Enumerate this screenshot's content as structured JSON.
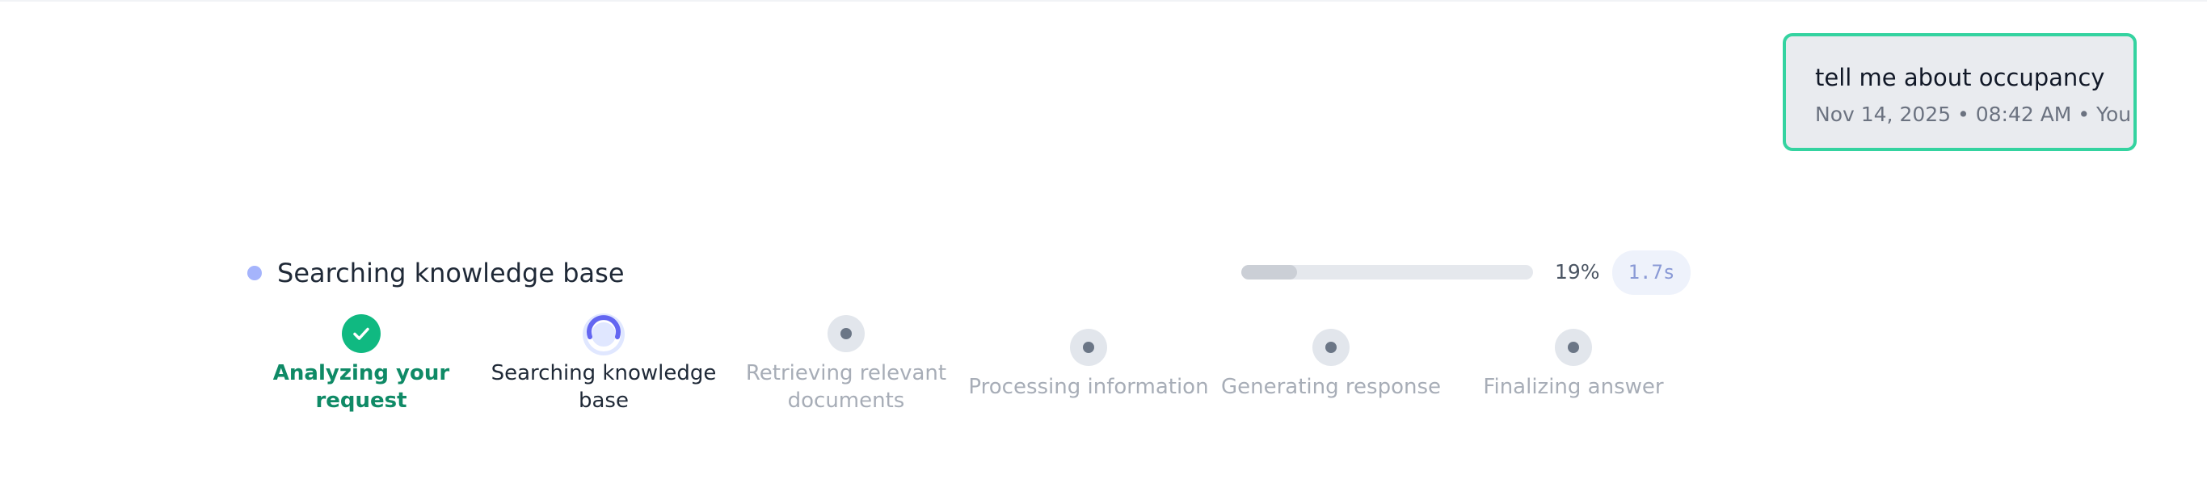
{
  "chat": {
    "user_message": {
      "text": "tell me about occupancy",
      "meta": "Nov 14, 2025 • 08:42 AM • You"
    }
  },
  "status": {
    "title": "Searching knowledge base",
    "progress_percent": 19,
    "progress_label": "19%",
    "elapsed": "1.7s"
  },
  "steps": [
    {
      "label": "Analyzing your request",
      "state": "done",
      "icon": "check-icon"
    },
    {
      "label": "Searching knowledge base",
      "state": "active",
      "icon": "spinner-icon"
    },
    {
      "label": "Retrieving relevant documents",
      "state": "pending",
      "icon": "pending-dot-icon"
    },
    {
      "label": "Processing information",
      "state": "pending",
      "icon": "pending-dot-icon"
    },
    {
      "label": "Generating response",
      "state": "pending",
      "icon": "pending-dot-icon"
    },
    {
      "label": "Finalizing answer",
      "state": "pending",
      "icon": "pending-dot-icon"
    }
  ],
  "colors": {
    "accent_green": "#10b981",
    "bubble_border": "#34d3a0",
    "active_indigo": "#6366f1",
    "pending_gray": "#a7adb7"
  }
}
